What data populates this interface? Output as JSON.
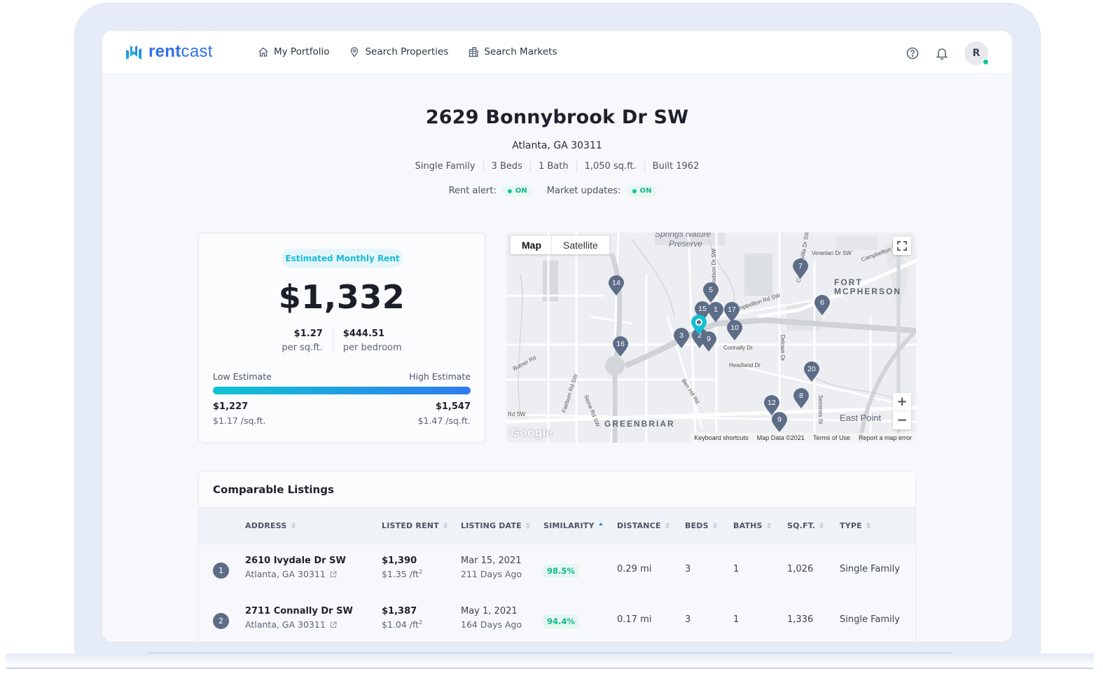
{
  "app": {
    "logo_bold": "rent",
    "logo_light": "cast",
    "brand_color": "#2f6fec",
    "accent_color": "#18bdd6"
  },
  "nav": {
    "items": [
      {
        "label": "My Portfolio",
        "icon": "home-icon"
      },
      {
        "label": "Search Properties",
        "icon": "map-pin-icon"
      },
      {
        "label": "Search Markets",
        "icon": "buildings-icon"
      }
    ],
    "help_icon": "help-circle-icon",
    "bell_icon": "bell-icon",
    "avatar_initial": "R"
  },
  "property": {
    "address": "2629 Bonnybrook Dr SW",
    "city": "Atlanta, GA 30311",
    "facts": [
      "Single Family",
      "3 Beds",
      "1 Bath",
      "1,050 sq.ft.",
      "Built 1962"
    ],
    "rent_alert_label": "Rent alert:",
    "rent_alert_state": "ON",
    "market_updates_label": "Market updates:",
    "market_updates_state": "ON"
  },
  "estimate": {
    "badge": "Estimated Monthly Rent",
    "amount": "$1,332",
    "per_sqft_value": "$1.27",
    "per_sqft_label": "per sq.ft.",
    "per_bedroom_value": "$444.51",
    "per_bedroom_label": "per bedroom",
    "low_label": "Low Estimate",
    "high_label": "High Estimate",
    "low_value": "$1,227",
    "low_per_sqft": "$1.17 /sq.ft.",
    "high_value": "$1,547",
    "high_per_sqft": "$1.47 /sq.ft."
  },
  "map": {
    "type_map": "Map",
    "type_satellite": "Satellite",
    "zoom_in": "+",
    "zoom_out": "−",
    "google": "Google",
    "footer": [
      "Keyboard shortcuts",
      "Map Data ©2021",
      "Terms of Use",
      "Report a map error"
    ],
    "labels": {
      "fort1": "FORT",
      "fort2": "MCPHERSON",
      "greenbriar": "GREENBRIAR",
      "east_point": "East Point",
      "springs1": "Springs Nature",
      "springs2": "Preserve",
      "venetian": "Venetian Dr SW",
      "campbellton1": "Campbellton Rd SW",
      "campbellton2": "Campbellton Rd SW",
      "connally": "Connally Dr",
      "headland": "Headland Dr",
      "butner": "Butner Rd",
      "fairburn": "Fairburn Rd SW",
      "stone": "Stone Rd SW",
      "benhill": "Ben Hill Rd",
      "delowe": "Delowe Dr",
      "semmes": "Semmes St",
      "rdsw": "Rd SW",
      "dodson": "Dodson Dr SW",
      "cascade": "Cascade Villa Dr SW"
    },
    "pins": [
      "14",
      "5",
      "1",
      "15",
      "17",
      "7",
      "6",
      "10",
      "3",
      "2",
      "9",
      "16",
      "20",
      "8",
      "12",
      "9"
    ],
    "pin_color": "#5d6d88",
    "subject_pin_color": "#14bfd3"
  },
  "comps": {
    "title": "Comparable Listings",
    "columns": [
      "ADDRESS",
      "LISTED RENT",
      "LISTING DATE",
      "SIMILARITY",
      "DISTANCE",
      "BEDS",
      "BATHS",
      "SQ.FT.",
      "TYPE"
    ],
    "sorted_column": "SIMILARITY",
    "rows": [
      {
        "rank": "1",
        "address": "2610 Ivydale Dr SW",
        "city": "Atlanta, GA 30311",
        "rent": "$1,390",
        "rent_per_ft": "$1.35 /ft",
        "date": "Mar 15, 2021",
        "days_ago": "211 Days Ago",
        "similarity": "98.5%",
        "distance": "0.29 mi",
        "beds": "3",
        "baths": "1",
        "sqft": "1,026",
        "type": "Single Family"
      },
      {
        "rank": "2",
        "address": "2711 Connally Dr SW",
        "city": "Atlanta, GA 30311",
        "rent": "$1,387",
        "rent_per_ft": "$1.04 /ft",
        "date": "May 1, 2021",
        "days_ago": "164 Days Ago",
        "similarity": "94.4%",
        "distance": "0.17 mi",
        "beds": "3",
        "baths": "1",
        "sqft": "1,336",
        "type": "Single Family"
      }
    ]
  }
}
